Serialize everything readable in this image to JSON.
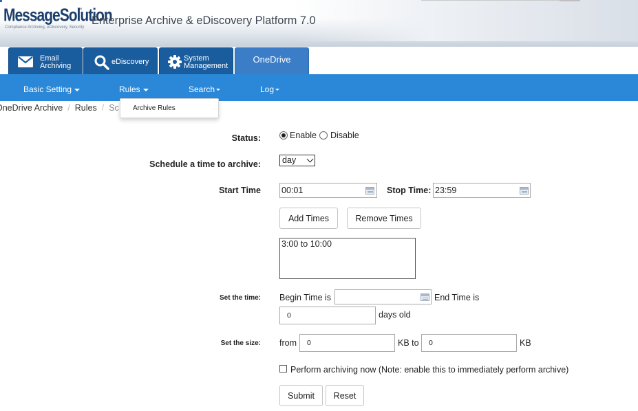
{
  "header": {
    "brand": "MessageSolution",
    "brand_tm": "™",
    "tagline": "Compliance Archiving, eDiscovery, Security",
    "app_title": "Enterprise Archive & eDiscovery Platform 7.0"
  },
  "module_tabs": [
    {
      "label_line1": "Email",
      "label_line2": "Archiving",
      "icon": "envelope-icon"
    },
    {
      "label_line1": "eDiscovery",
      "label_line2": "",
      "icon": "search-icon"
    },
    {
      "label_line1": "System",
      "label_line2": "Management",
      "icon": "gear-icon"
    },
    {
      "label_line1": "OneDrive",
      "label_line2": "",
      "icon": "",
      "active": true
    }
  ],
  "navbar": {
    "items": [
      "Basic Setting",
      "Rules",
      "Search",
      "Log"
    ]
  },
  "breadcrumb": {
    "items": [
      "OneDrive Archive",
      "Rules",
      "Sc"
    ]
  },
  "rules_dropdown": {
    "items": [
      "Archive Rules"
    ]
  },
  "form": {
    "status_label": "Status:",
    "enable_label": "Enable",
    "disable_label": "Disable",
    "schedule_label": "Schedule a time to archive:",
    "schedule_value": "day",
    "start_time_label": "Start Time",
    "start_time_value": "00:01",
    "stop_time_label": "Stop Time:",
    "stop_time_value": "23:59",
    "add_times_label": "Add Times",
    "remove_times_label": "Remove Times",
    "times_list": [
      "3:00 to 10:00"
    ],
    "set_time_label": "Set the time:",
    "begin_time_label": "Begin Time is",
    "begin_time_value": "",
    "end_time_label": "End Time is",
    "days_value": "0",
    "days_old_label": "days old",
    "set_size_label": "Set the size:",
    "from_label": "from",
    "size_from_value": "0",
    "kb_to_label": "KB to",
    "size_to_value": "0",
    "kb_label": "KB",
    "perform_now_label": "Perform archiving now (Note: enable this to immediately perform archive)",
    "submit_label": "Submit",
    "reset_label": "Reset"
  },
  "colors": {
    "navbar": "#2b88d8",
    "module_tab": "#1a5d9e",
    "module_tab_active": "#3b7ec7"
  }
}
